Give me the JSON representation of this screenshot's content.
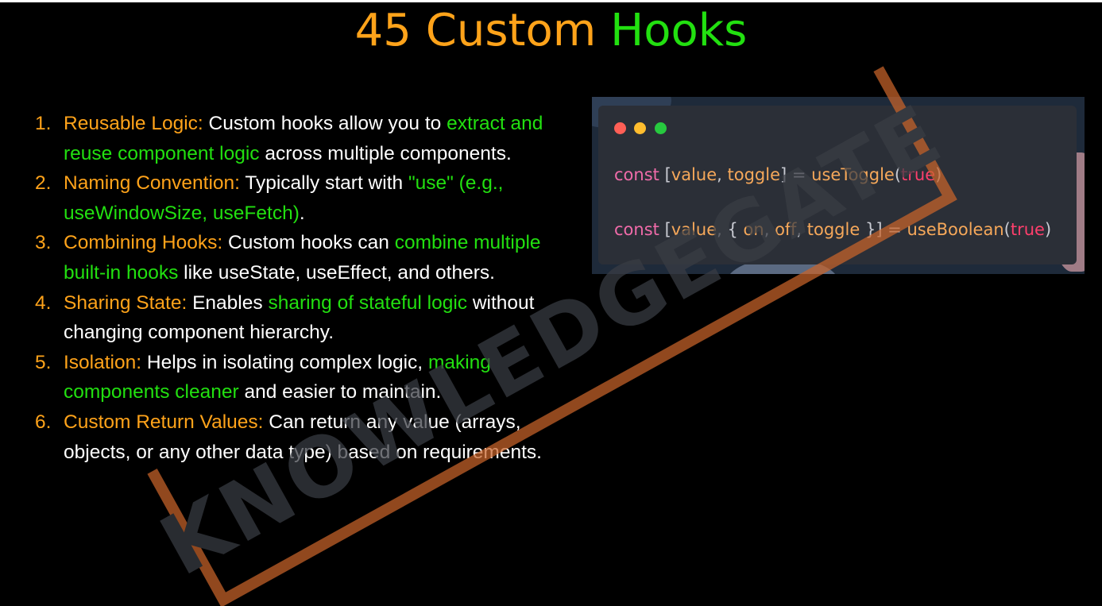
{
  "title": {
    "number": "45",
    "word1": "Custom",
    "word2": "Hooks"
  },
  "points": [
    {
      "num": "1.",
      "label": "Reusable Logic:",
      "t1": " Custom hooks allow you to ",
      "hl": "extract and reuse component logic",
      "t2": " across multiple components."
    },
    {
      "num": "2.",
      "label": "Naming Convention:",
      "t1": " Typically start with ",
      "hl": "\"use\" (e.g., useWindowSize, useFetch)",
      "t2": "."
    },
    {
      "num": "3.",
      "label": "Combining Hooks:",
      "t1": " Custom hooks can ",
      "hl": "combine multiple built-in hooks",
      "t2": " like useState, useEffect, and others."
    },
    {
      "num": "4.",
      "label": "Sharing State:",
      "t1": " Enables ",
      "hl": "sharing of stateful logic",
      "t2": " without changing component hierarchy."
    },
    {
      "num": "5.",
      "label": "Isolation:",
      "t1": " Helps in isolating complex logic, ",
      "hl": "making components cleaner",
      "t2": " and easier to maintain."
    },
    {
      "num": "6.",
      "label": "Custom Return Values:",
      "t1": " Can return any value (arrays, objects, or any other data type) based on requirements.",
      "hl": "",
      "t2": ""
    }
  ],
  "code": {
    "line1": {
      "kw": "const",
      "open": " [",
      "v1": "value",
      "comma": ", ",
      "v2": "toggle",
      "close": "] = ",
      "fn": "useToggle",
      "po": "(",
      "bool": "true",
      "pc": ")"
    },
    "line2": {
      "kw": "const",
      "open": " [",
      "v1": "value",
      "comma": ", ",
      "brace_open": "{ ",
      "v2": "on",
      "c2": ", ",
      "v3": "off",
      "c3": ", ",
      "v4": "toggle",
      "brace_close": " }",
      "close": "] = ",
      "fn": "useBoolean",
      "po": "(",
      "bool": "true",
      "pc": ")"
    }
  },
  "watermark": {
    "text": "KNOWLEDGEGATE"
  },
  "colors": {
    "orange": "#ffa31a",
    "green": "#22e010",
    "background": "#000000"
  }
}
